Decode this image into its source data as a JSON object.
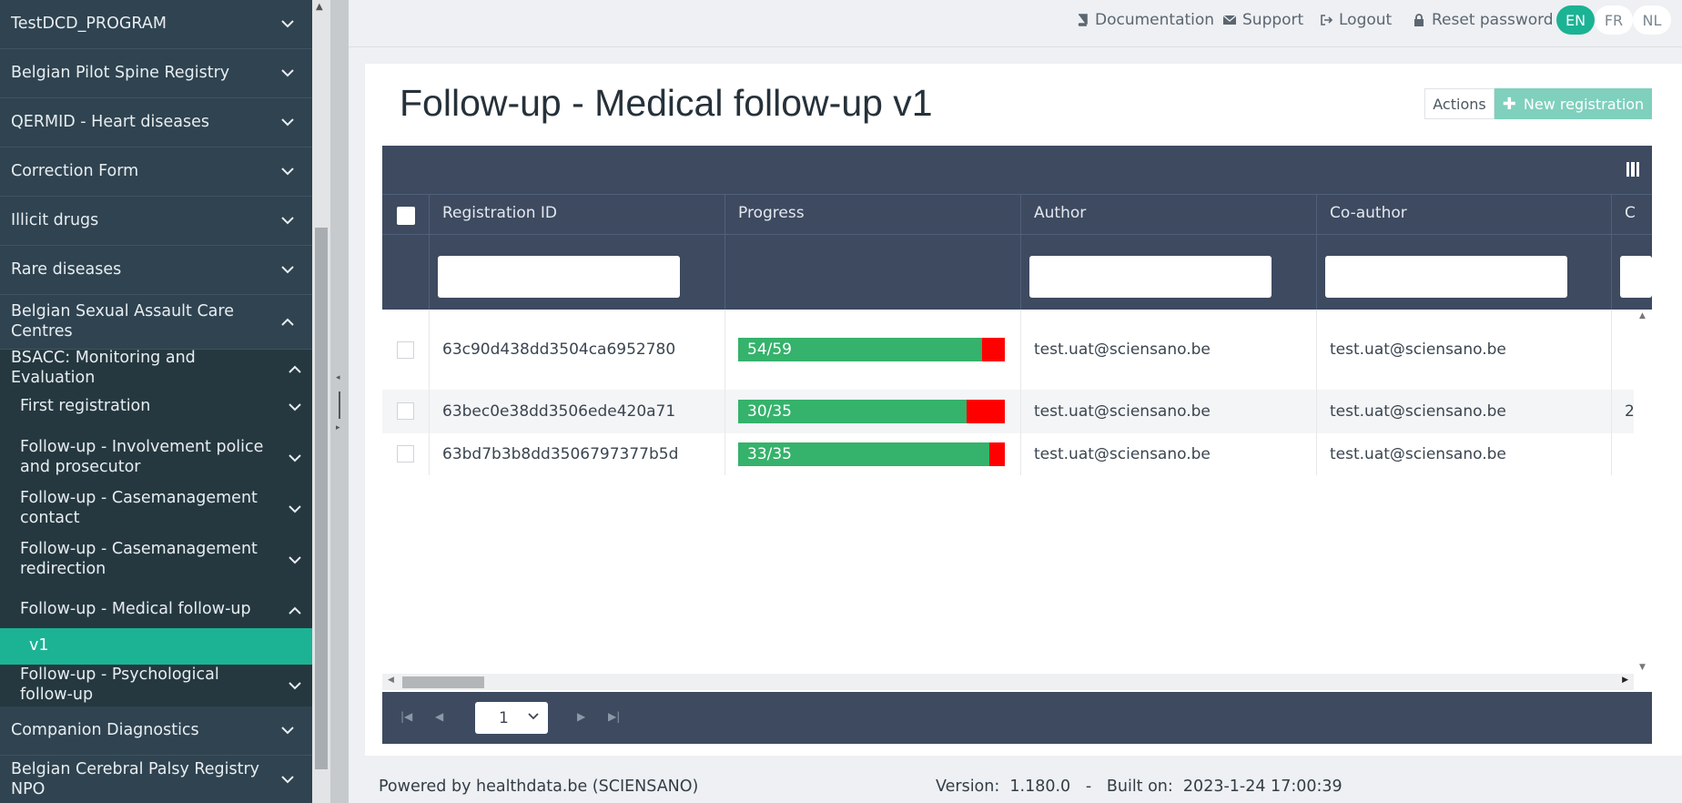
{
  "sidebar": {
    "items": [
      {
        "label": "TestDCD_PROGRAM",
        "state": "collapsed"
      },
      {
        "label": "Belgian Pilot Spine Registry",
        "state": "collapsed"
      },
      {
        "label": "QERMID - Heart diseases",
        "state": "collapsed"
      },
      {
        "label": "Correction Form",
        "state": "collapsed"
      },
      {
        "label": "Illicit drugs",
        "state": "collapsed"
      },
      {
        "label": "Rare diseases",
        "state": "collapsed"
      },
      {
        "label": "Belgian Sexual Assault Care Centres",
        "state": "expanded"
      }
    ],
    "group": {
      "label": "BSACC: Monitoring and Evaluation",
      "state": "expanded"
    },
    "subitems": [
      {
        "label": "First registration",
        "state": "collapsed"
      },
      {
        "label": "Follow-up - Involvement police and prosecutor",
        "state": "collapsed"
      },
      {
        "label": "Follow-up - Casemanagement contact",
        "state": "collapsed"
      },
      {
        "label": "Follow-up - Casemanagement redirection",
        "state": "collapsed"
      },
      {
        "label": "Follow-up - Medical follow-up",
        "state": "expanded"
      }
    ],
    "active_item": "v1",
    "after_items": [
      {
        "label": "Follow-up - Psychological follow-up",
        "state": "collapsed"
      },
      {
        "label": "Companion Diagnostics",
        "state": "collapsed"
      },
      {
        "label": "Belgian Cerebral Palsy Registry NPO",
        "state": "collapsed"
      }
    ]
  },
  "topbar": {
    "documentation": "Documentation",
    "support": "Support",
    "logout": "Logout",
    "reset_password": "Reset password",
    "languages": [
      "EN",
      "FR",
      "NL"
    ],
    "active_language": "EN"
  },
  "page": {
    "title": "Follow-up - Medical follow-up v1",
    "actions_label": "Actions",
    "new_registration_label": "New registration"
  },
  "grid": {
    "columns": [
      "Registration ID",
      "Progress",
      "Author",
      "Co-author",
      "C"
    ],
    "rows": [
      {
        "id": "63c90d438dd3504ca6952780",
        "progress_text": "54/59",
        "progress_done": 54,
        "progress_total": 59,
        "author": "test.uat@sciensano.be",
        "coauthor": "test.uat@sciensano.be",
        "extra": ""
      },
      {
        "id": "63bec0e38dd3506ede420a71",
        "progress_text": "30/35",
        "progress_done": 30,
        "progress_total": 35,
        "author": "test.uat@sciensano.be",
        "coauthor": "test.uat@sciensano.be",
        "extra": "2"
      },
      {
        "id": "63bd7b3b8dd3506797377b5d",
        "progress_text": "33/35",
        "progress_done": 33,
        "progress_total": 35,
        "author": "test.uat@sciensano.be",
        "coauthor": "test.uat@sciensano.be",
        "extra": ""
      }
    ],
    "current_page": "1"
  },
  "colors": {
    "sidebar_bg": "#2f4350",
    "accent": "#1bb394",
    "grid_header": "#3d4a60",
    "progress_done": "#35b26b",
    "progress_remaining": "#ff0000"
  },
  "footer": {
    "powered_by": "Powered by healthdata.be (SCIENSANO)",
    "version_text": "Version:  1.180.0   -   Built on:  2023-1-24 17:00:39"
  }
}
